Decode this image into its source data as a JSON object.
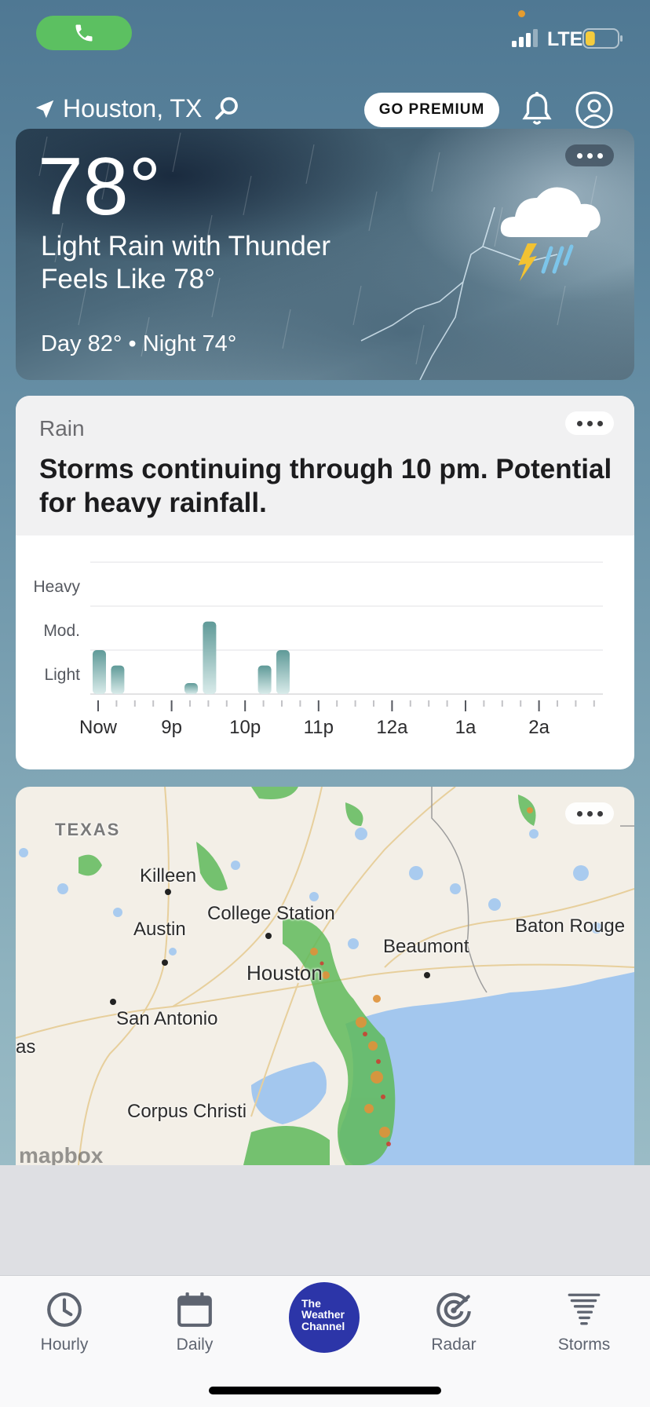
{
  "status_bar": {
    "network": "LTE",
    "battery_level": 0.3,
    "colors": {
      "call": "#5cc061",
      "battery": "#f5cc3d"
    }
  },
  "header": {
    "location": "Houston, TX",
    "premium_button": "GO PREMIUM"
  },
  "current": {
    "temperature": "78°",
    "condition": "Light Rain with Thunder",
    "feels_like": "Feels Like 78°",
    "day_night": "Day 82° • Night 74°",
    "icon": "cloud-thunder-rain-icon"
  },
  "rain_card": {
    "title": "Rain",
    "headline": "Storms continuing through 10 pm. Potential for heavy rainfall."
  },
  "chart_data": {
    "type": "bar",
    "y_levels": [
      "Light",
      "Mod.",
      "Heavy"
    ],
    "x_tick_labels": [
      "Now",
      "9p",
      "10p",
      "11p",
      "12a",
      "1a",
      "2a"
    ],
    "interval_minutes": 15,
    "values": [
      1.0,
      0.65,
      0,
      0,
      0,
      0.25,
      1.65,
      0,
      0,
      0.65,
      1.0
    ],
    "ylim": [
      0,
      3
    ],
    "colors": {
      "bar_top": "#5f9a98",
      "bar_bottom": "#d9ebea"
    }
  },
  "map": {
    "region_label": "TEXAS",
    "cities": [
      {
        "id": "killeen",
        "label": "Killeen"
      },
      {
        "id": "college-station",
        "label": "College Station"
      },
      {
        "id": "austin",
        "label": "Austin"
      },
      {
        "id": "baton-rouge",
        "label": "Baton Rouge"
      },
      {
        "id": "beaumont",
        "label": "Beaumont"
      },
      {
        "id": "houston",
        "label": "Houston"
      },
      {
        "id": "san-antonio",
        "label": "San Antonio"
      },
      {
        "id": "corpus-christi",
        "label": "Corpus Christi"
      },
      {
        "id": "edge",
        "label": "as"
      }
    ],
    "attribution": "mapbox"
  },
  "tabs": [
    {
      "id": "hourly",
      "label": "Hourly",
      "icon": "clock-icon"
    },
    {
      "id": "daily",
      "label": "Daily",
      "icon": "calendar-icon"
    },
    {
      "id": "home",
      "label": "The Weather Channel",
      "icon": "weather-channel-logo"
    },
    {
      "id": "radar",
      "label": "Radar",
      "icon": "radar-icon"
    },
    {
      "id": "storms",
      "label": "Storms",
      "icon": "tornado-icon"
    }
  ],
  "logo_text": [
    "The",
    "Weather",
    "Channel"
  ]
}
